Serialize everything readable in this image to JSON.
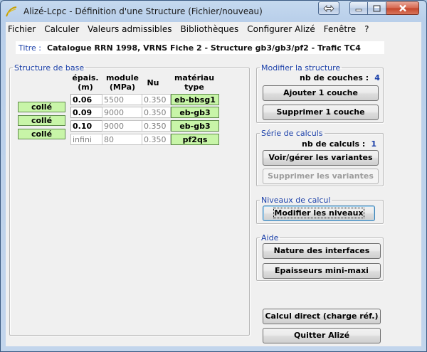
{
  "window": {
    "title": "Alizé-Lcpc - Définition d'une Structure (Fichier/nouveau)"
  },
  "menu": [
    {
      "label": "Fichier"
    },
    {
      "label": "Calculer"
    },
    {
      "label": "Valeurs admissibles"
    },
    {
      "label": "Bibliothèques"
    },
    {
      "label": "Configurer Alizé"
    },
    {
      "label": "Fenêtre"
    },
    {
      "label": "?"
    }
  ],
  "titre": {
    "label": "Titre :",
    "value": "Catalogue RRN 1998, VRNS Fiche 2 - Structure gb3/gb3/pf2 - Trafic TC4"
  },
  "structure": {
    "legend": "Structure de base",
    "headers": {
      "epais": "épais.",
      "epais_unit": "(m)",
      "module": "module",
      "module_unit": "(MPa)",
      "nu": "Nu",
      "materiau": "matériau",
      "materiau_sub": "type"
    },
    "layers": [
      {
        "epais": "0.06",
        "module": "5500",
        "nu": "0.350",
        "materiau": "eb-bbsg1"
      },
      {
        "epais": "0.09",
        "module": "9000",
        "nu": "0.350",
        "materiau": "eb-gb3"
      },
      {
        "epais": "0.10",
        "module": "9000",
        "nu": "0.350",
        "materiau": "eb-gb3"
      },
      {
        "epais": "infini",
        "module": "80",
        "nu": "0.350",
        "materiau": "pf2qs"
      }
    ],
    "interfaces": [
      "collé",
      "collé",
      "collé"
    ]
  },
  "modifier": {
    "legend": "Modifier la structure",
    "count_label": "nb de couches :",
    "count": "4",
    "add_label": "Ajouter 1 couche",
    "remove_label": "Supprimer 1 couche"
  },
  "serie": {
    "legend": "Série de calculs",
    "count_label": "nb de calculs :",
    "count": "1",
    "view_label": "Voir/gérer les variantes",
    "delete_label": "Supprimer les variantes"
  },
  "niveaux": {
    "legend": "Niveaux de calcul",
    "modify_label": "Modifier les niveaux"
  },
  "aide": {
    "legend": "Aide",
    "interfaces_label": "Nature des interfaces",
    "epaisseurs_label": "Epaisseurs mini-maxi"
  },
  "actions": {
    "calcul_label": "Calcul direct (charge réf.)",
    "quit_label": "Quitter Alizé"
  },
  "colors": {
    "accent": "#1a3fa8",
    "material_fill": "#c8f5a8"
  }
}
